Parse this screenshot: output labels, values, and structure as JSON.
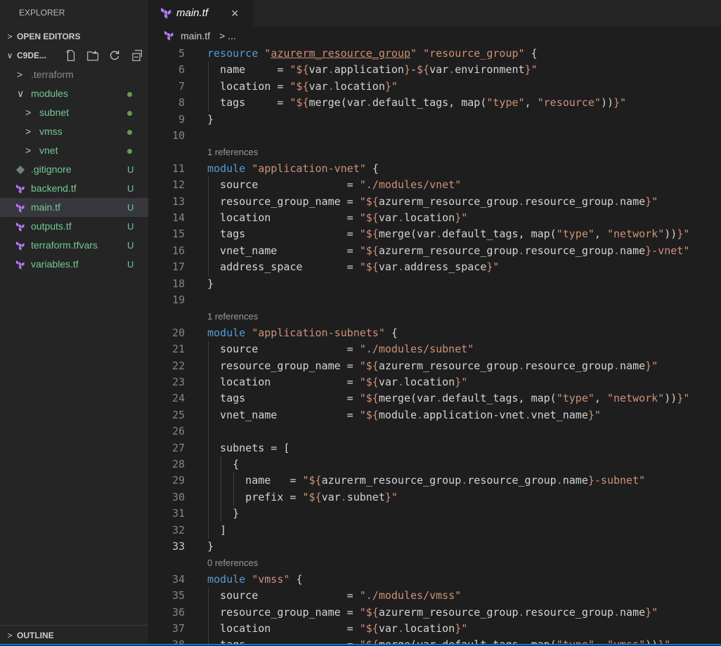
{
  "sidebar": {
    "title": "EXPLORER",
    "open_editors": {
      "chevron": ">",
      "label": "OPEN EDITORS"
    },
    "workspace": {
      "chevron": "∨",
      "label": "C9DE..."
    },
    "tree": [
      {
        "label": ".terraform",
        "type": "folder",
        "chevron": ">",
        "color": "#8c8c8c"
      },
      {
        "label": "modules",
        "type": "folder",
        "chevron": "∨",
        "color": "#73c991",
        "dot": true
      },
      {
        "label": "subnet",
        "type": "folder",
        "chevron": ">",
        "color": "#73c991",
        "dot": true
      },
      {
        "label": "vmss",
        "type": "folder",
        "chevron": ">",
        "color": "#73c991",
        "dot": true
      },
      {
        "label": "vnet",
        "type": "folder",
        "chevron": ">",
        "color": "#73c991",
        "dot": true
      },
      {
        "label": ".gitignore",
        "type": "git-file",
        "status": "U",
        "color": "#73c991"
      },
      {
        "label": "backend.tf",
        "type": "terraform-file",
        "status": "U",
        "color": "#73c991"
      },
      {
        "label": "main.tf",
        "type": "terraform-file",
        "status": "U",
        "color": "#73c991",
        "selected": true
      },
      {
        "label": "outputs.tf",
        "type": "terraform-file",
        "status": "U",
        "color": "#73c991"
      },
      {
        "label": "terraform.tfvars",
        "type": "terraform-file",
        "status": "U",
        "color": "#73c991"
      },
      {
        "label": "variables.tf",
        "type": "terraform-file",
        "status": "U",
        "color": "#73c991"
      }
    ],
    "outline": {
      "chevron": ">",
      "label": "OUTLINE"
    }
  },
  "tab": {
    "label": "main.tf",
    "close": "×"
  },
  "breadcrumb": {
    "file": "main.tf",
    "rest": "> ..."
  },
  "editor": {
    "active_line": 33,
    "lines": [
      {
        "n": 5,
        "tokens": [
          [
            "kw",
            "resource"
          ],
          [
            "pl",
            " "
          ],
          [
            "str",
            "\""
          ],
          [
            "strd",
            "azurerm_resource_group"
          ],
          [
            "str",
            "\""
          ],
          [
            "pl",
            " "
          ],
          [
            "str",
            "\"resource_group\""
          ],
          [
            "pl",
            " "
          ],
          [
            "br",
            "{"
          ]
        ]
      },
      {
        "n": 6,
        "tokens": [
          [
            "pl",
            "  name     = "
          ],
          [
            "str",
            "\"${"
          ],
          [
            "pl",
            "var"
          ],
          [
            "dot",
            "."
          ],
          [
            "pl",
            "application"
          ],
          [
            "str",
            "}"
          ],
          [
            "pl",
            "-"
          ],
          [
            "str",
            "${"
          ],
          [
            "pl",
            "var"
          ],
          [
            "dot",
            "."
          ],
          [
            "pl",
            "environment"
          ],
          [
            "str",
            "}\""
          ]
        ]
      },
      {
        "n": 7,
        "tokens": [
          [
            "pl",
            "  location = "
          ],
          [
            "str",
            "\"${"
          ],
          [
            "pl",
            "var"
          ],
          [
            "dot",
            "."
          ],
          [
            "pl",
            "location"
          ],
          [
            "str",
            "}\""
          ]
        ]
      },
      {
        "n": 8,
        "tokens": [
          [
            "pl",
            "  tags     = "
          ],
          [
            "str",
            "\"${"
          ],
          [
            "pl",
            "merge(var"
          ],
          [
            "dot",
            "."
          ],
          [
            "pl",
            "default_tags, map("
          ],
          [
            "str",
            "\"type\""
          ],
          [
            "pl",
            ", "
          ],
          [
            "str",
            "\"resource\""
          ],
          [
            "pl",
            "))"
          ],
          [
            "str",
            "}\""
          ]
        ]
      },
      {
        "n": 9,
        "tokens": [
          [
            "br",
            "}"
          ]
        ]
      },
      {
        "n": 10,
        "tokens": []
      },
      {
        "lens": "1 references"
      },
      {
        "n": 11,
        "tokens": [
          [
            "kw",
            "module"
          ],
          [
            "pl",
            " "
          ],
          [
            "str",
            "\"application-vnet\""
          ],
          [
            "pl",
            " "
          ],
          [
            "br",
            "{"
          ]
        ]
      },
      {
        "n": 12,
        "tokens": [
          [
            "pl",
            "  source              = "
          ],
          [
            "str",
            "\"./modules/vnet\""
          ]
        ]
      },
      {
        "n": 13,
        "tokens": [
          [
            "pl",
            "  resource_group_name = "
          ],
          [
            "str",
            "\"${"
          ],
          [
            "pl",
            "azurerm_resource_group"
          ],
          [
            "dot",
            "."
          ],
          [
            "pl",
            "resource_group"
          ],
          [
            "dot",
            "."
          ],
          [
            "pl",
            "name"
          ],
          [
            "str",
            "}\""
          ]
        ]
      },
      {
        "n": 14,
        "tokens": [
          [
            "pl",
            "  location            = "
          ],
          [
            "str",
            "\"${"
          ],
          [
            "pl",
            "var"
          ],
          [
            "dot",
            "."
          ],
          [
            "pl",
            "location"
          ],
          [
            "str",
            "}\""
          ]
        ]
      },
      {
        "n": 15,
        "tokens": [
          [
            "pl",
            "  tags                = "
          ],
          [
            "str",
            "\"${"
          ],
          [
            "pl",
            "merge(var"
          ],
          [
            "dot",
            "."
          ],
          [
            "pl",
            "default_tags, map("
          ],
          [
            "str",
            "\"type\""
          ],
          [
            "pl",
            ", "
          ],
          [
            "str",
            "\"network\""
          ],
          [
            "pl",
            "))"
          ],
          [
            "str",
            "}\""
          ]
        ]
      },
      {
        "n": 16,
        "tokens": [
          [
            "pl",
            "  vnet_name           = "
          ],
          [
            "str",
            "\"${"
          ],
          [
            "pl",
            "azurerm_resource_group"
          ],
          [
            "dot",
            "."
          ],
          [
            "pl",
            "resource_group"
          ],
          [
            "dot",
            "."
          ],
          [
            "pl",
            "name"
          ],
          [
            "str",
            "}-vnet\""
          ]
        ]
      },
      {
        "n": 17,
        "tokens": [
          [
            "pl",
            "  address_space       = "
          ],
          [
            "str",
            "\"${"
          ],
          [
            "pl",
            "var"
          ],
          [
            "dot",
            "."
          ],
          [
            "pl",
            "address_space"
          ],
          [
            "str",
            "}\""
          ]
        ]
      },
      {
        "n": 18,
        "tokens": [
          [
            "br",
            "}"
          ]
        ]
      },
      {
        "n": 19,
        "tokens": []
      },
      {
        "lens": "1 references"
      },
      {
        "n": 20,
        "tokens": [
          [
            "kw",
            "module"
          ],
          [
            "pl",
            " "
          ],
          [
            "str",
            "\"application-subnets\""
          ],
          [
            "pl",
            " "
          ],
          [
            "br",
            "{"
          ]
        ]
      },
      {
        "n": 21,
        "tokens": [
          [
            "pl",
            "  source              = "
          ],
          [
            "str",
            "\"./modules/subnet\""
          ]
        ]
      },
      {
        "n": 22,
        "tokens": [
          [
            "pl",
            "  resource_group_name = "
          ],
          [
            "str",
            "\"${"
          ],
          [
            "pl",
            "azurerm_resource_group"
          ],
          [
            "dot",
            "."
          ],
          [
            "pl",
            "resource_group"
          ],
          [
            "dot",
            "."
          ],
          [
            "pl",
            "name"
          ],
          [
            "str",
            "}\""
          ]
        ]
      },
      {
        "n": 23,
        "tokens": [
          [
            "pl",
            "  location            = "
          ],
          [
            "str",
            "\"${"
          ],
          [
            "pl",
            "var"
          ],
          [
            "dot",
            "."
          ],
          [
            "pl",
            "location"
          ],
          [
            "str",
            "}\""
          ]
        ]
      },
      {
        "n": 24,
        "tokens": [
          [
            "pl",
            "  tags                = "
          ],
          [
            "str",
            "\"${"
          ],
          [
            "pl",
            "merge(var"
          ],
          [
            "dot",
            "."
          ],
          [
            "pl",
            "default_tags, map("
          ],
          [
            "str",
            "\"type\""
          ],
          [
            "pl",
            ", "
          ],
          [
            "str",
            "\"network\""
          ],
          [
            "pl",
            "))"
          ],
          [
            "str",
            "}\""
          ]
        ]
      },
      {
        "n": 25,
        "tokens": [
          [
            "pl",
            "  vnet_name           = "
          ],
          [
            "str",
            "\"${"
          ],
          [
            "pl",
            "module"
          ],
          [
            "dot",
            "."
          ],
          [
            "pl",
            "application-vnet"
          ],
          [
            "dot",
            "."
          ],
          [
            "pl",
            "vnet_name"
          ],
          [
            "str",
            "}\""
          ]
        ]
      },
      {
        "n": 26,
        "tokens": []
      },
      {
        "n": 27,
        "tokens": [
          [
            "pl",
            "  subnets = ["
          ]
        ]
      },
      {
        "n": 28,
        "tokens": [
          [
            "pl",
            "    {"
          ]
        ]
      },
      {
        "n": 29,
        "tokens": [
          [
            "pl",
            "      name   = "
          ],
          [
            "str",
            "\"${"
          ],
          [
            "pl",
            "azurerm_resource_group"
          ],
          [
            "dot",
            "."
          ],
          [
            "pl",
            "resource_group"
          ],
          [
            "dot",
            "."
          ],
          [
            "pl",
            "name"
          ],
          [
            "str",
            "}-subnet\""
          ]
        ]
      },
      {
        "n": 30,
        "tokens": [
          [
            "pl",
            "      prefix = "
          ],
          [
            "str",
            "\"${"
          ],
          [
            "pl",
            "var"
          ],
          [
            "dot",
            "."
          ],
          [
            "pl",
            "subnet"
          ],
          [
            "str",
            "}\""
          ]
        ]
      },
      {
        "n": 31,
        "tokens": [
          [
            "pl",
            "    "
          ],
          [
            "br",
            "}"
          ]
        ]
      },
      {
        "n": 32,
        "tokens": [
          [
            "pl",
            "  ]"
          ]
        ]
      },
      {
        "n": 33,
        "tokens": [
          [
            "br",
            "}"
          ]
        ]
      },
      {
        "lens": "0 references"
      },
      {
        "n": 34,
        "tokens": [
          [
            "kw",
            "module"
          ],
          [
            "pl",
            " "
          ],
          [
            "str",
            "\"vmss\""
          ],
          [
            "pl",
            " "
          ],
          [
            "br",
            "{"
          ]
        ]
      },
      {
        "n": 35,
        "tokens": [
          [
            "pl",
            "  source              = "
          ],
          [
            "str",
            "\"./modules/vmss\""
          ]
        ]
      },
      {
        "n": 36,
        "tokens": [
          [
            "pl",
            "  resource_group_name = "
          ],
          [
            "str",
            "\"${"
          ],
          [
            "pl",
            "azurerm_resource_group"
          ],
          [
            "dot",
            "."
          ],
          [
            "pl",
            "resource_group"
          ],
          [
            "dot",
            "."
          ],
          [
            "pl",
            "name"
          ],
          [
            "str",
            "}\""
          ]
        ]
      },
      {
        "n": 37,
        "tokens": [
          [
            "pl",
            "  location            = "
          ],
          [
            "str",
            "\"${"
          ],
          [
            "pl",
            "var"
          ],
          [
            "dot",
            "."
          ],
          [
            "pl",
            "location"
          ],
          [
            "str",
            "}\""
          ]
        ]
      },
      {
        "n": 38,
        "tokens": [
          [
            "pl",
            "  tags                = "
          ],
          [
            "str",
            "\"${"
          ],
          [
            "pl",
            "merge(var"
          ],
          [
            "dot",
            "."
          ],
          [
            "pl",
            "default_tags, map("
          ],
          [
            "str",
            "\"type\""
          ],
          [
            "pl",
            ", "
          ],
          [
            "str",
            "\"vmss\""
          ],
          [
            "pl",
            "))"
          ],
          [
            "str",
            "}\""
          ]
        ]
      }
    ]
  }
}
